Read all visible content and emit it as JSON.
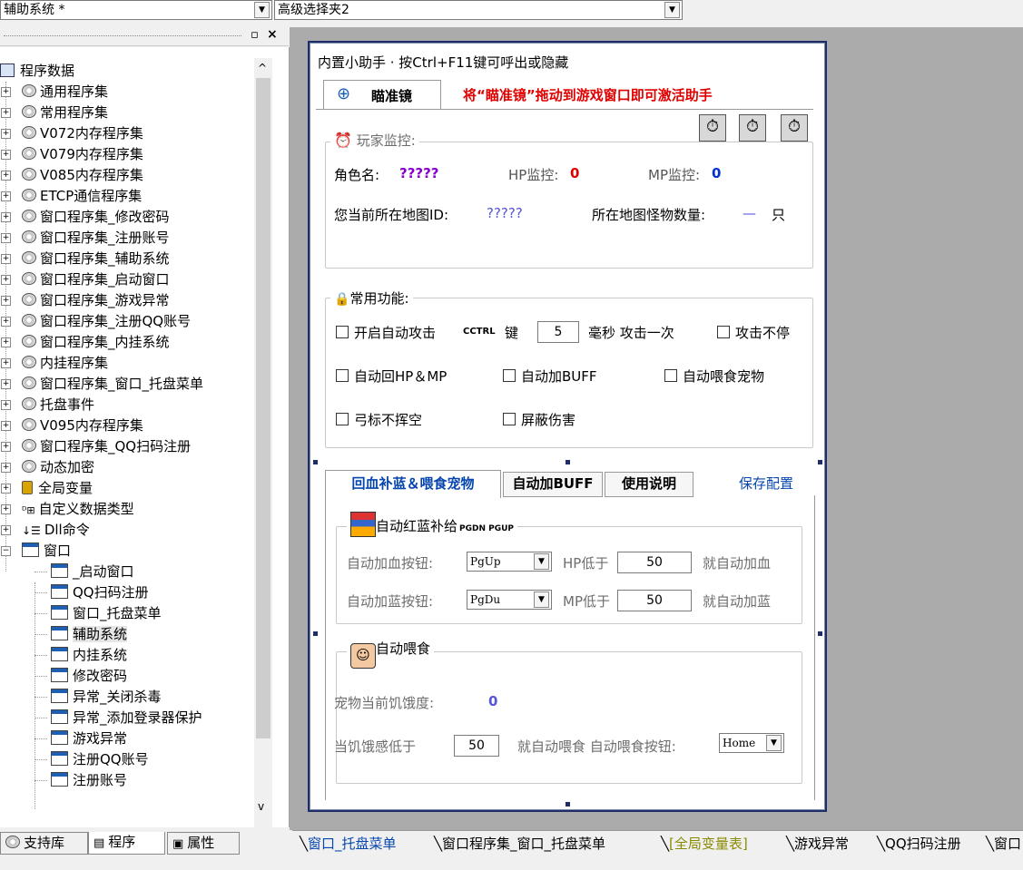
{
  "top": {
    "combo_left": "辅助系统 *",
    "combo_right": "高级选择夹2"
  },
  "tree": {
    "root": "程序数据",
    "items": [
      {
        "label": "通用程序集",
        "icon": "cd"
      },
      {
        "label": "常用程序集",
        "icon": "cd"
      },
      {
        "label": "V072内存程序集",
        "icon": "cd"
      },
      {
        "label": "V079内存程序集",
        "icon": "cd"
      },
      {
        "label": "V085内存程序集",
        "icon": "cd"
      },
      {
        "label": "ETCP通信程序集",
        "icon": "cd"
      },
      {
        "label": "窗口程序集_修改密码",
        "icon": "cd"
      },
      {
        "label": "窗口程序集_注册账号",
        "icon": "cd"
      },
      {
        "label": "窗口程序集_辅助系统",
        "icon": "cd"
      },
      {
        "label": "窗口程序集_启动窗口",
        "icon": "cd"
      },
      {
        "label": "窗口程序集_游戏异常",
        "icon": "cd"
      },
      {
        "label": "窗口程序集_注册QQ账号",
        "icon": "cd"
      },
      {
        "label": "窗口程序集_内挂系统",
        "icon": "cd"
      },
      {
        "label": "内挂程序集",
        "icon": "cd"
      },
      {
        "label": "窗口程序集_窗口_托盘菜单",
        "icon": "cd"
      },
      {
        "label": "托盘事件",
        "icon": "cd"
      },
      {
        "label": "V095内存程序集",
        "icon": "cd"
      },
      {
        "label": "窗口程序集_QQ扫码注册",
        "icon": "cd"
      },
      {
        "label": "动态加密",
        "icon": "cd"
      },
      {
        "label": "全局变量",
        "icon": "db"
      },
      {
        "label": "自定义数据类型",
        "icon": "type"
      },
      {
        "label": "Dll命令",
        "icon": "dll"
      },
      {
        "label": "窗口",
        "icon": "win"
      }
    ],
    "windows": [
      "_启动窗口",
      "QQ扫码注册",
      "窗口_托盘菜单",
      "辅助系统",
      "内挂系统",
      "修改密码",
      "异常_关闭杀毒",
      "异常_添加登录器保护",
      "游戏异常",
      "注册QQ账号",
      "注册账号"
    ],
    "selected": "辅助系统"
  },
  "left_tabs": [
    "支持库",
    "程序",
    "属性"
  ],
  "dialog": {
    "title": "内置小助手 · 按Ctrl+F11键可呼出或隐藏",
    "tab_label": "瞄准镜",
    "tab_hint": "将“瞄准镜”拖动到游戏窗口即可激活助手",
    "player_group": "玩家监控:",
    "role_label": "角色名:",
    "role_value": "?????",
    "hp_label": "HP监控:",
    "hp_value": "0",
    "mp_label": "MP监控:",
    "mp_value": "0",
    "map_label": "您当前所在地图ID:",
    "map_value": "?????",
    "monster_label": "所在地图怪物数量:",
    "monster_value": "—",
    "monster_unit": "只",
    "common_group": "常用功能:",
    "auto_attack": "开启自动攻击",
    "ctrl_glyph": "CCTRL",
    "key_label": "键",
    "interval_value": "5",
    "interval_suffix": "毫秒 攻击一次",
    "attack_nonstop": "攻击不停",
    "auto_hpmp": "自动回HP＆MP",
    "auto_buff": "自动加BUFF",
    "auto_feed": "自动喂食宠物",
    "bow_miss": "弓标不挥空",
    "block_damage": "屏蔽伤害",
    "tabs": [
      "回血补蓝＆喂食宠物",
      "自动加BUFF",
      "使用说明"
    ],
    "save_config": "保存配置",
    "potion_group": "自动红蓝补给",
    "potion_glyph": "PGDN PGUP",
    "hp_btn_label": "自动加血按钮:",
    "hp_btn_value": "PgUp",
    "hp_below": "HP低于",
    "hp_threshold": "50",
    "hp_action": "就自动加血",
    "mp_btn_label": "自动加蓝按钮:",
    "mp_btn_value": "PgDu",
    "mp_below": "MP低于",
    "mp_threshold": "50",
    "mp_action": "就自动加蓝",
    "feed_group": "自动喂食",
    "hunger_label": "宠物当前饥饿度:",
    "hunger_value": "0",
    "feed_below": "当饥饿感低于",
    "feed_threshold": "50",
    "feed_action": "就自动喂食 自动喂食按钮:",
    "feed_btn_value": "Home"
  },
  "bottom_tabs": [
    "窗口_托盘菜单",
    "窗口程序集_窗口_托盘菜单",
    "[全局变量表]",
    "游戏异常",
    "QQ扫码注册",
    "窗口"
  ],
  "colors": {
    "accent_red": "#e00000",
    "link_blue": "#0645ad",
    "purple": "#8800cc",
    "gray_bg": "#ababab"
  }
}
